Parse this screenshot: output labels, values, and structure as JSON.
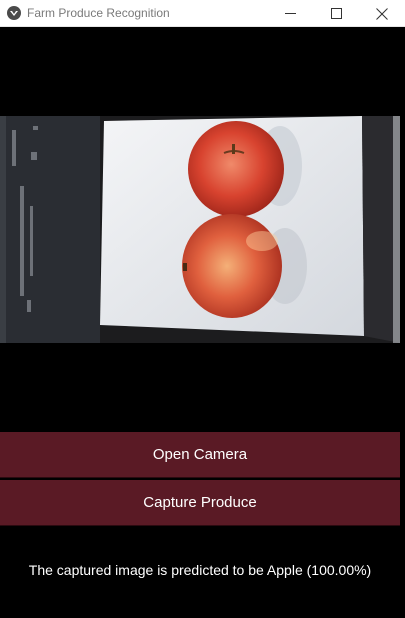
{
  "window": {
    "title": "Farm Produce Recognition",
    "minimize_glyph": "—",
    "maximize_glyph": "☐",
    "close_glyph": "✕"
  },
  "camera_preview": {
    "image": "two red apples stacked on white paper, phone screen visible on left"
  },
  "buttons": {
    "open_camera": "Open Camera",
    "capture_produce": "Capture Produce"
  },
  "result": {
    "text": "The captured image is predicted to be Apple (100.00%)"
  },
  "colors": {
    "button_bg": "#5a1a25",
    "background": "#000000"
  }
}
